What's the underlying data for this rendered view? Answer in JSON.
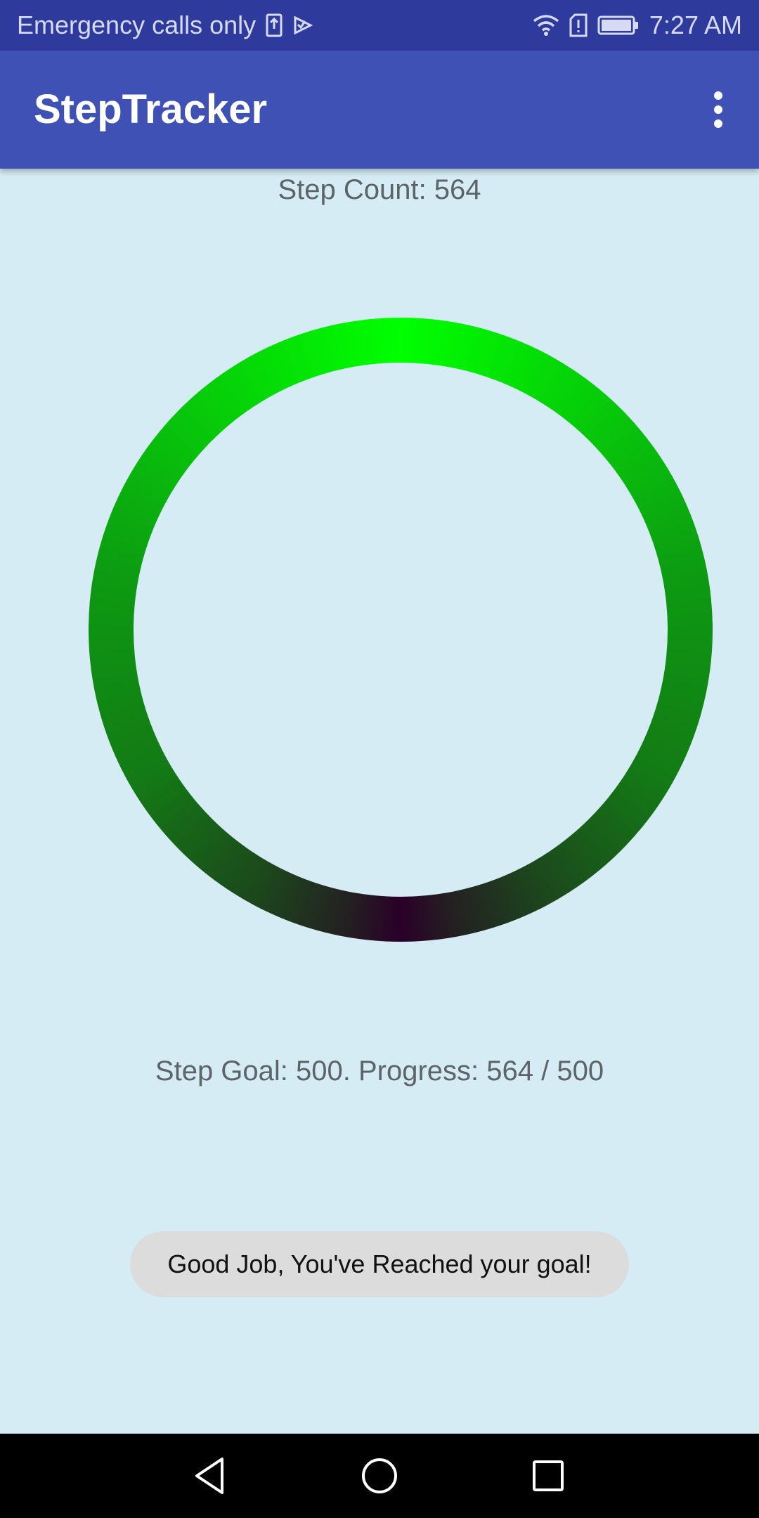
{
  "status_bar": {
    "carrier_text": "Emergency calls only",
    "time": "7:27 AM",
    "icons": [
      "sim-alert-icon",
      "notification-icon",
      "wifi-icon",
      "sim-warning-icon",
      "battery-icon"
    ]
  },
  "app_bar": {
    "title": "StepTracker",
    "menu_icon": "overflow-menu-icon"
  },
  "main": {
    "step_count_text": "Step Count: 564",
    "progress": {
      "steps": 564,
      "goal": 500,
      "fraction_complete": 1.0
    },
    "goal_text": "Step Goal: 500. Progress: 564 / 500"
  },
  "toast": {
    "message": "Good Job, You've Reached your goal!"
  },
  "nav_bar": {
    "buttons": [
      "back-icon",
      "home-icon",
      "recents-icon"
    ]
  },
  "colors": {
    "status_bar": "#2e3b9c",
    "app_bar": "#3f51b5",
    "background": "#d5ecf5",
    "ring_top": "#00ff00",
    "ring_bottom": "#2a0028",
    "toast_bg": "#dcdcdc"
  }
}
